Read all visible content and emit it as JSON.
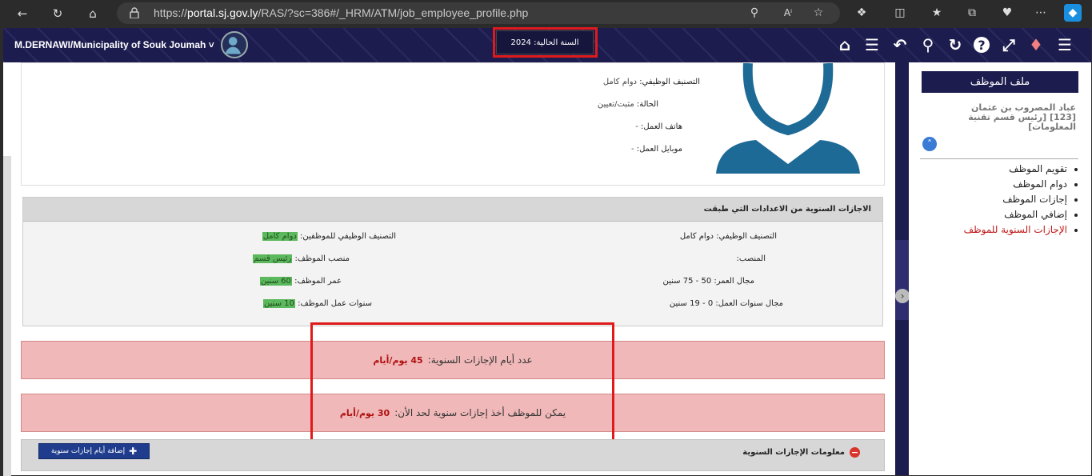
{
  "browser": {
    "url_prefix": "https://",
    "url_host": "portal.sj.gov.ly",
    "url_path": "/RAS/?sc=386#/_HRM/ATM/job_employee_profile.php"
  },
  "header": {
    "user": "M.DERNAWI/Municipality of Souk Joumah",
    "current_year_label": "السنة الحالية: 2024"
  },
  "profile": {
    "classification_label": "التصنيف الوظيفي:",
    "classification_value": "دوام كامل",
    "status_label": "الحالة:",
    "status_value": "مثبت/تعيين",
    "work_phone_label": "هاتف العمل:",
    "work_phone_value": "-",
    "work_mobile_label": "موبايل العمل:",
    "work_mobile_value": "-"
  },
  "settings": {
    "title": "الاجازات السنوية من الاعدادات التي طبقت",
    "right": [
      {
        "label": "التصنيف الوظيفي:",
        "value": "دوام كامل"
      },
      {
        "label": "المنصب:",
        "value": ""
      },
      {
        "label": "مجال العمر:",
        "value": "50 - 75 سنين"
      },
      {
        "label": "مجال سنوات العمل:",
        "value": "0 - 19 سنين"
      }
    ],
    "left": [
      {
        "label": "التصنيف الوظيفي للموظفين:",
        "value": "دوام كامل"
      },
      {
        "label": "منصب الموظف:",
        "value": "رئيس قسم"
      },
      {
        "label": "عمر الموظف:",
        "value": "60 سنين"
      },
      {
        "label": "سنوات عمل الموظف:",
        "value": "10 سنين"
      }
    ]
  },
  "alerts": {
    "annual_days_label": "عدد أيام الإجازات السنوية:",
    "annual_days_value": "45 يوم/أيام",
    "can_take_label": "يمكن للموظف أخذ إجازات سنوية لحد الأن:",
    "can_take_value": "30 يوم/أيام"
  },
  "leave_info": {
    "title": "معلومات الإجازات السنوية",
    "add_button": "إضافة أيام إجازات سنوية"
  },
  "sidebar": {
    "title": "ملف الموظف",
    "employee_name": "عباد المصروب بن عثمان [123] [رئيس قسم تقنية المعلومات]",
    "items": [
      {
        "label": "تقويم الموظف",
        "active": false
      },
      {
        "label": "دوام الموظف",
        "active": false
      },
      {
        "label": "إجازات الموظف",
        "active": false
      },
      {
        "label": "إضافي الموظف",
        "active": false
      },
      {
        "label": "الإجازات السنوية للموظف",
        "active": true
      }
    ]
  }
}
